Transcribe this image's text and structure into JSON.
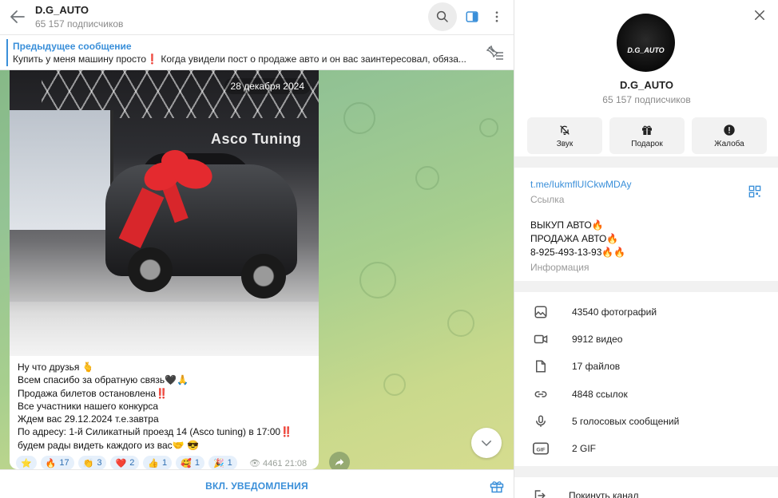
{
  "header": {
    "title": "D.G_AUTO",
    "subscribers": "65 157 подписчиков"
  },
  "pinned": {
    "title": "Предыдущее сообщение",
    "text": "Купить у меня машину просто❗️ Когда увидели пост о продаже авто и он вас заинтересовал, обяза..."
  },
  "message": {
    "date": "28 декабря 2024",
    "photo_sign": "Asco Tuning",
    "caption_lines": [
      "Ну что друзья 🫰",
      "Всем спасибо за обратную связь🖤🙏",
      "Продажа билетов остановлена‼️",
      "Все участники нашего конкурса",
      "Ждем вас 29.12.2024 т.е.завтра",
      "По адресу: 1-й Силикатный проезд 14 (Asco tuning) в 17:00‼️",
      "будем рады видеть каждого из вас🤝 😎"
    ],
    "reactions": [
      {
        "emoji": "⭐",
        "count": ""
      },
      {
        "emoji": "🔥",
        "count": "17"
      },
      {
        "emoji": "👏",
        "count": "3"
      },
      {
        "emoji": "❤️",
        "count": "2"
      },
      {
        "emoji": "👍",
        "count": "1"
      },
      {
        "emoji": "🥰",
        "count": "1"
      },
      {
        "emoji": "🎉",
        "count": "1"
      }
    ],
    "views": "4461",
    "time": "21:08"
  },
  "footer": {
    "notifications_label": "ВКЛ. УВЕДОМЛЕНИЯ"
  },
  "info": {
    "avatar_text": "D.G_AUTO",
    "name": "D.G_AUTO",
    "subscribers": "65 157 подписчиков",
    "actions": {
      "sound": "Звук",
      "gift": "Подарок",
      "report": "Жалоба"
    },
    "link": "t.me/IukmflUICkwMDAy",
    "link_label": "Ссылка",
    "description_lines": [
      "ВЫКУП АВТО🔥",
      "ПРОДАЖА АВТО🔥",
      "8-925-493-13-93🔥🔥"
    ],
    "description_label": "Информация",
    "media": {
      "photos": "43540 фотографий",
      "videos": "9912 видео",
      "files": "17 файлов",
      "links": "4848 ссылок",
      "voice": "5 голосовых сообщений",
      "gif": "2 GIF"
    },
    "leave": "Покинуть канал"
  },
  "colors": {
    "accent": "#3a8fd9",
    "chat_bg": "#93c394",
    "panel_button_bg": "#f2f2f2"
  }
}
